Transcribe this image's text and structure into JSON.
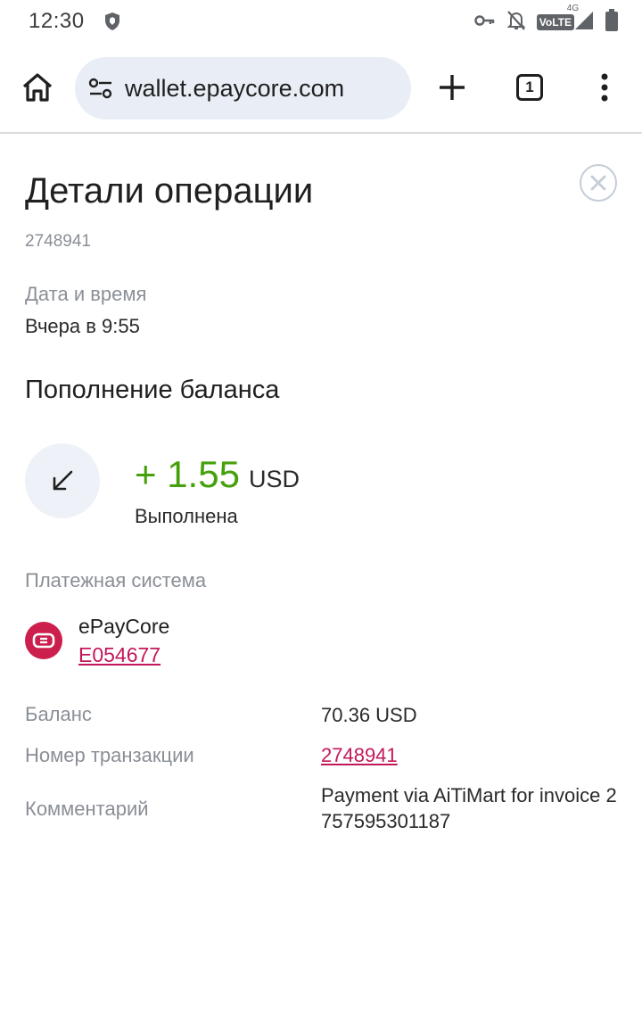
{
  "status_bar": {
    "time": "12:30",
    "volte_label": "VoLTE",
    "network_label": "4G",
    "icons": [
      "shield-icon",
      "key-icon",
      "bell-off-icon",
      "signal-icon",
      "battery-icon"
    ]
  },
  "browser": {
    "url": "wallet.epaycore.com",
    "tab_count": "1",
    "icons": [
      "home-icon",
      "site-settings-icon",
      "plus-icon",
      "more-vert-icon"
    ]
  },
  "operation": {
    "title": "Детали операции",
    "id": "2748941",
    "datetime_label": "Дата и время",
    "datetime_value": "Вчера в 9:55",
    "type": "Пополнение баланса",
    "amount": "+ 1.55",
    "currency": "USD",
    "status": "Выполнена",
    "payment_system_label": "Платежная система",
    "payment_system_name": "ePayCore",
    "payment_system_account": "E054677",
    "balance_label": "Баланс",
    "balance_value": "70.36 USD",
    "transaction_label": "Номер транзакции",
    "transaction_value": "2748941",
    "comment_label": "Комментарий",
    "comment_value": "Payment via AiTiMart for invoice 2757595301187"
  },
  "colors": {
    "amount_green": "#46a00b",
    "link_red": "#c2185b",
    "brand_logo": "#cc1f4d",
    "url_bar_bg": "#e9eef6"
  }
}
